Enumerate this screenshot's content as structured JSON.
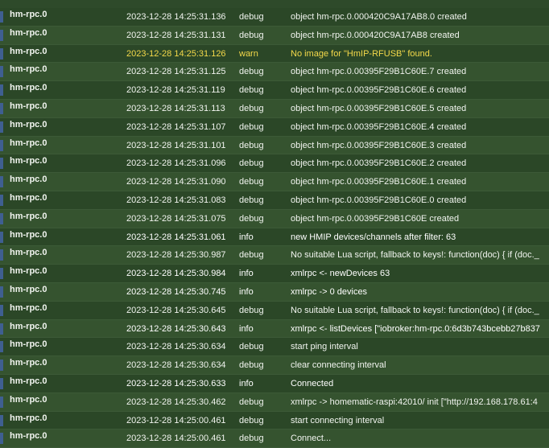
{
  "log": {
    "rows": [
      {
        "source": "hm-rpc.0",
        "time": "2023-12-28 14:25:31.136",
        "level": "debug",
        "message": "object hm-rpc.0.000420C9A17AB8.0 created"
      },
      {
        "source": "hm-rpc.0",
        "time": "2023-12-28 14:25:31.131",
        "level": "debug",
        "message": "object hm-rpc.0.000420C9A17AB8 created"
      },
      {
        "source": "hm-rpc.0",
        "time": "2023-12-28 14:25:31.126",
        "level": "warn",
        "message": "No image for \"HmIP-RFUSB\" found."
      },
      {
        "source": "hm-rpc.0",
        "time": "2023-12-28 14:25:31.125",
        "level": "debug",
        "message": "object hm-rpc.0.00395F29B1C60E.7 created"
      },
      {
        "source": "hm-rpc.0",
        "time": "2023-12-28 14:25:31.119",
        "level": "debug",
        "message": "object hm-rpc.0.00395F29B1C60E.6 created"
      },
      {
        "source": "hm-rpc.0",
        "time": "2023-12-28 14:25:31.113",
        "level": "debug",
        "message": "object hm-rpc.0.00395F29B1C60E.5 created"
      },
      {
        "source": "hm-rpc.0",
        "time": "2023-12-28 14:25:31.107",
        "level": "debug",
        "message": "object hm-rpc.0.00395F29B1C60E.4 created"
      },
      {
        "source": "hm-rpc.0",
        "time": "2023-12-28 14:25:31.101",
        "level": "debug",
        "message": "object hm-rpc.0.00395F29B1C60E.3 created"
      },
      {
        "source": "hm-rpc.0",
        "time": "2023-12-28 14:25:31.096",
        "level": "debug",
        "message": "object hm-rpc.0.00395F29B1C60E.2 created"
      },
      {
        "source": "hm-rpc.0",
        "time": "2023-12-28 14:25:31.090",
        "level": "debug",
        "message": "object hm-rpc.0.00395F29B1C60E.1 created"
      },
      {
        "source": "hm-rpc.0",
        "time": "2023-12-28 14:25:31.083",
        "level": "debug",
        "message": "object hm-rpc.0.00395F29B1C60E.0 created"
      },
      {
        "source": "hm-rpc.0",
        "time": "2023-12-28 14:25:31.075",
        "level": "debug",
        "message": "object hm-rpc.0.00395F29B1C60E created"
      },
      {
        "source": "hm-rpc.0",
        "time": "2023-12-28 14:25:31.061",
        "level": "info",
        "message": "new HMIP devices/channels after filter: 63"
      },
      {
        "source": "hm-rpc.0",
        "time": "2023-12-28 14:25:30.987",
        "level": "debug",
        "message": "No suitable Lua script, fallback to keys!: function(doc) { if (doc._"
      },
      {
        "source": "hm-rpc.0",
        "time": "2023-12-28 14:25:30.984",
        "level": "info",
        "message": "xmlrpc <- newDevices 63"
      },
      {
        "source": "hm-rpc.0",
        "time": "2023-12-28 14:25:30.745",
        "level": "info",
        "message": "xmlrpc -> 0 devices"
      },
      {
        "source": "hm-rpc.0",
        "time": "2023-12-28 14:25:30.645",
        "level": "debug",
        "message": "No suitable Lua script, fallback to keys!: function(doc) { if (doc._"
      },
      {
        "source": "hm-rpc.0",
        "time": "2023-12-28 14:25:30.643",
        "level": "info",
        "message": "xmlrpc <- listDevices [\"iobroker:hm-rpc.0:6d3b743bcebb27b837"
      },
      {
        "source": "hm-rpc.0",
        "time": "2023-12-28 14:25:30.634",
        "level": "debug",
        "message": "start ping interval"
      },
      {
        "source": "hm-rpc.0",
        "time": "2023-12-28 14:25:30.634",
        "level": "debug",
        "message": "clear connecting interval"
      },
      {
        "source": "hm-rpc.0",
        "time": "2023-12-28 14:25:30.633",
        "level": "info",
        "message": "Connected"
      },
      {
        "source": "hm-rpc.0",
        "time": "2023-12-28 14:25:30.462",
        "level": "debug",
        "message": "xmlrpc -> homematic-raspi:42010/ init [\"http://192.168.178.61:4"
      },
      {
        "source": "hm-rpc.0",
        "time": "2023-12-28 14:25:00.461",
        "level": "debug",
        "message": "start connecting interval"
      },
      {
        "source": "hm-rpc.0",
        "time": "2023-12-28 14:25:00.461",
        "level": "debug",
        "message": "Connect..."
      }
    ]
  },
  "colors": {
    "background": "#2e4a2a",
    "text": "#f1f4ef",
    "warn": "#f4d94a",
    "marker": "#3f5f91"
  }
}
